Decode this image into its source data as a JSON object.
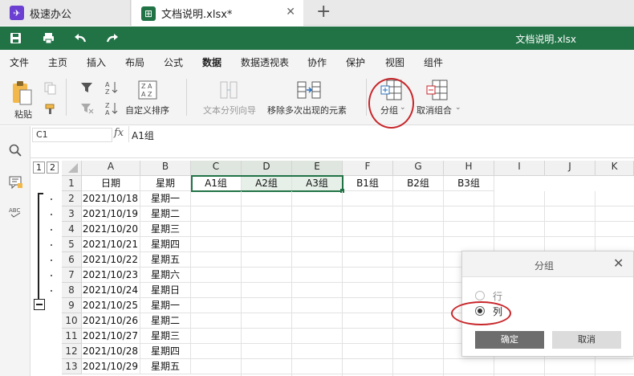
{
  "tabs": [
    {
      "label": "极速办公",
      "icon": "app-logo-icon"
    },
    {
      "label": "文档说明.xlsx*",
      "icon": "spreadsheet-icon"
    }
  ],
  "title_bar": {
    "doc_title": "文档说明.xlsx"
  },
  "menu": [
    "文件",
    "主页",
    "插入",
    "布局",
    "公式",
    "数据",
    "数据透视表",
    "协作",
    "保护",
    "视图",
    "组件"
  ],
  "ribbon": {
    "paste": "粘贴",
    "custom_sort": "自定义排序",
    "text_to_columns": "文本分列向导",
    "remove_duplicates": "移除多次出现的元素",
    "group": "分组",
    "ungroup": "取消组合"
  },
  "formula_bar": {
    "name_box": "C1",
    "fx": "fx",
    "formula": "A1组"
  },
  "outline_levels": [
    "1",
    "2"
  ],
  "columns": [
    "A",
    "B",
    "C",
    "D",
    "E",
    "F",
    "G",
    "H",
    "I",
    "J",
    "K"
  ],
  "header_row": [
    "日期",
    "星期",
    "A1组",
    "A2组",
    "A3组",
    "B1组",
    "B2组",
    "B3组"
  ],
  "rows": [
    {
      "n": "1"
    },
    {
      "n": "2",
      "date": "2021/10/18",
      "week": "星期一"
    },
    {
      "n": "3",
      "date": "2021/10/19",
      "week": "星期二"
    },
    {
      "n": "4",
      "date": "2021/10/20",
      "week": "星期三"
    },
    {
      "n": "5",
      "date": "2021/10/21",
      "week": "星期四"
    },
    {
      "n": "6",
      "date": "2021/10/22",
      "week": "星期五"
    },
    {
      "n": "7",
      "date": "2021/10/23",
      "week": "星期六"
    },
    {
      "n": "8",
      "date": "2021/10/24",
      "week": "星期日"
    },
    {
      "n": "9",
      "date": "2021/10/25",
      "week": "星期一"
    },
    {
      "n": "10",
      "date": "2021/10/26",
      "week": "星期二"
    },
    {
      "n": "11",
      "date": "2021/10/27",
      "week": "星期三"
    },
    {
      "n": "12",
      "date": "2021/10/28",
      "week": "星期四"
    },
    {
      "n": "13",
      "date": "2021/10/29",
      "week": "星期五"
    }
  ],
  "dialog": {
    "title": "分组",
    "option_row": "行",
    "option_col": "列",
    "selected": "列",
    "ok": "确定",
    "cancel": "取消"
  },
  "colors": {
    "brand_green": "#217346",
    "selection_green": "#217346",
    "annotation_red": "#c8262b"
  }
}
